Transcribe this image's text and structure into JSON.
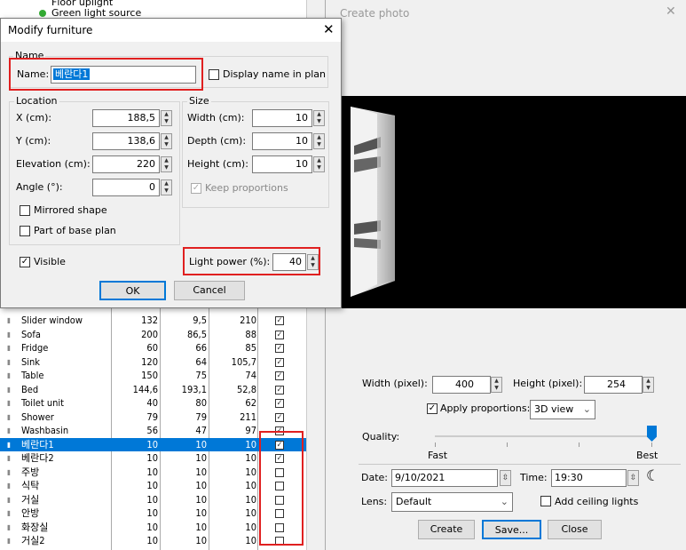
{
  "tree": {
    "item1": "Floor uplight",
    "item2": "Green light source"
  },
  "furniture_dialog": {
    "title": "Modify furniture",
    "close": "✕",
    "name_group": "Name",
    "name_label": "Name:",
    "name_value": "베란다1",
    "display_name_in_plan": "Display name in plan",
    "location_group": "Location",
    "x_label": "X (cm):",
    "x_value": "188,5",
    "y_label": "Y (cm):",
    "y_value": "138,6",
    "elevation_label": "Elevation (cm):",
    "elevation_value": "220",
    "angle_label": "Angle (°):",
    "angle_value": "0",
    "mirrored_shape": "Mirrored shape",
    "part_of_base_plan": "Part of base plan",
    "size_group": "Size",
    "width_label": "Width (cm):",
    "width_value": "10",
    "depth_label": "Depth (cm):",
    "depth_value": "10",
    "height_label": "Height (cm):",
    "height_value": "10",
    "keep_proportions": "Keep proportions",
    "visible": "Visible",
    "light_power_label": "Light power (%):",
    "light_power_value": "40",
    "ok": "OK",
    "cancel": "Cancel"
  },
  "furniture_table": {
    "rows": [
      {
        "name": "Slider window",
        "w": "132",
        "d": "9,5",
        "h": "210",
        "visible": true,
        "selected": false
      },
      {
        "name": "Sofa",
        "w": "200",
        "d": "86,5",
        "h": "88",
        "visible": true,
        "selected": false
      },
      {
        "name": "Fridge",
        "w": "60",
        "d": "66",
        "h": "85",
        "visible": true,
        "selected": false
      },
      {
        "name": "Sink",
        "w": "120",
        "d": "64",
        "h": "105,7",
        "visible": true,
        "selected": false
      },
      {
        "name": "Table",
        "w": "150",
        "d": "75",
        "h": "74",
        "visible": true,
        "selected": false
      },
      {
        "name": "Bed",
        "w": "144,6",
        "d": "193,1",
        "h": "52,8",
        "visible": true,
        "selected": false
      },
      {
        "name": "Toilet unit",
        "w": "40",
        "d": "80",
        "h": "62",
        "visible": true,
        "selected": false
      },
      {
        "name": "Shower",
        "w": "79",
        "d": "79",
        "h": "211",
        "visible": true,
        "selected": false
      },
      {
        "name": "Washbasin",
        "w": "56",
        "d": "47",
        "h": "97",
        "visible": true,
        "selected": false
      },
      {
        "name": "베란다1",
        "w": "10",
        "d": "10",
        "h": "10",
        "visible": true,
        "selected": true
      },
      {
        "name": "베란다2",
        "w": "10",
        "d": "10",
        "h": "10",
        "visible": true,
        "selected": false
      },
      {
        "name": "주방",
        "w": "10",
        "d": "10",
        "h": "10",
        "visible": false,
        "selected": false
      },
      {
        "name": "식탁",
        "w": "10",
        "d": "10",
        "h": "10",
        "visible": false,
        "selected": false
      },
      {
        "name": "거실",
        "w": "10",
        "d": "10",
        "h": "10",
        "visible": false,
        "selected": false
      },
      {
        "name": "안방",
        "w": "10",
        "d": "10",
        "h": "10",
        "visible": false,
        "selected": false
      },
      {
        "name": "화장실",
        "w": "10",
        "d": "10",
        "h": "10",
        "visible": false,
        "selected": false
      },
      {
        "name": "거실2",
        "w": "10",
        "d": "10",
        "h": "10",
        "visible": false,
        "selected": false
      }
    ]
  },
  "photo": {
    "title": "Create photo",
    "close": "✕",
    "width_label": "Width (pixel):",
    "width_value": "400",
    "height_label": "Height (pixel):",
    "height_value": "254",
    "apply_proportions": "Apply proportions:",
    "proportions_value": "3D view",
    "quality_label": "Quality:",
    "quality_fast": "Fast",
    "quality_best": "Best",
    "date_label": "Date:",
    "date_value": "9/10/2021",
    "time_label": "Time:",
    "time_value": "19:30",
    "lens_label": "Lens:",
    "lens_value": "Default",
    "add_ceiling_lights": "Add ceiling lights",
    "create": "Create",
    "save": "Save...",
    "close_btn": "Close"
  }
}
